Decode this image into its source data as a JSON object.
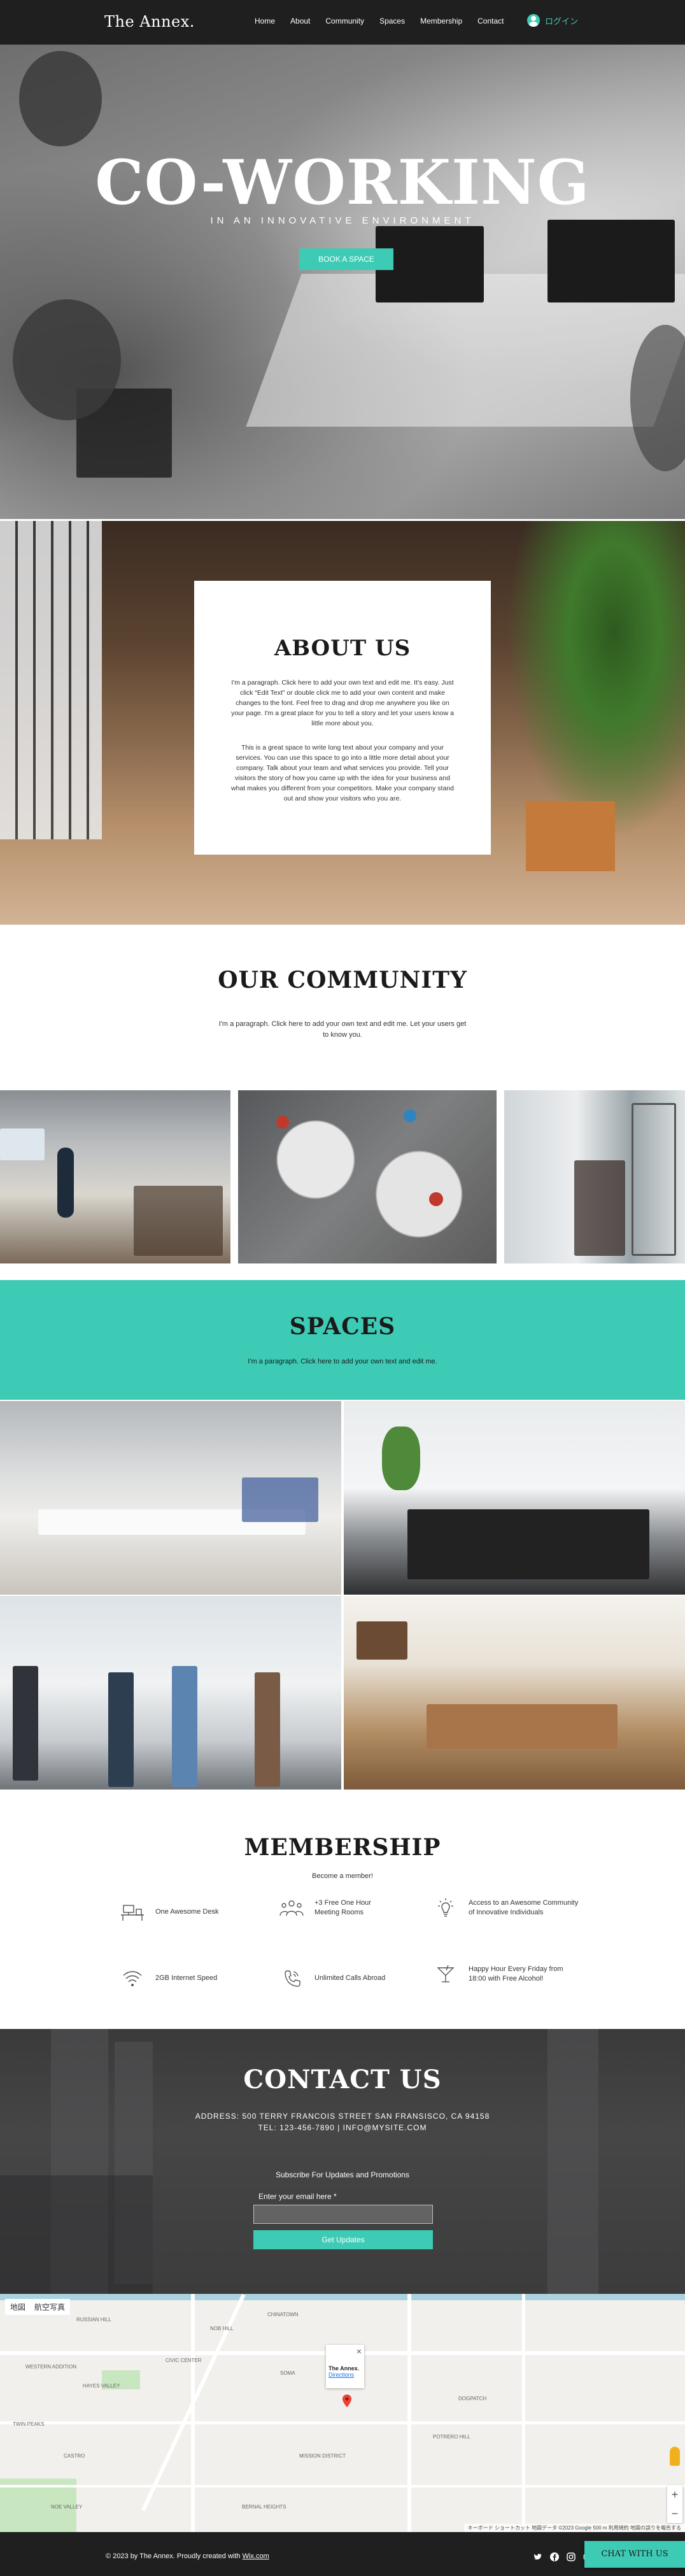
{
  "header": {
    "logo": "The Annex.",
    "nav": [
      "Home",
      "About",
      "Community",
      "Spaces",
      "Membership",
      "Contact"
    ],
    "login_label": "ログイン",
    "bg": "#1f1f1f",
    "accent": "#3ecbb5"
  },
  "hero": {
    "title": "CO-WORKING",
    "subtitle": "IN AN INNOVATIVE ENVIRONMENT",
    "button": "BOOK A SPACE"
  },
  "about": {
    "title": "ABOUT US",
    "p1": "I'm a paragraph. Click here to add your own text and edit me. It's easy. Just click “Edit Text” or double click me to add your own content and make changes to the font. Feel free to drag and drop me anywhere you like on your page. I'm a great place for you to tell a story and let your users know a little more about you.",
    "p2": "This is a great space to write long text about your company and your services. You can use this space to go into a little more detail about your company. Talk about your team and what services you provide. Tell your visitors the story of how you came up with the idea for your business and what makes you different from your competitors. Make your company stand out and show your visitors who you are."
  },
  "community": {
    "title": "OUR COMMUNITY",
    "text": "I'm a paragraph. Click here to add your own text and edit me. Let your users get to know you."
  },
  "spaces": {
    "title": "SPACES",
    "text": "I'm a paragraph. Click here to add your own text and edit me."
  },
  "membership": {
    "title": "MEMBERSHIP",
    "subtitle": "Become a member!",
    "perks": [
      {
        "icon": "desk-icon",
        "text": "One Awesome Desk"
      },
      {
        "icon": "meeting-people-icon",
        "text": "+3 Free One Hour Meeting Rooms"
      },
      {
        "icon": "lightbulb-icon",
        "text": "Access to an Awesome Community of Innovative Individuals"
      },
      {
        "icon": "wifi-icon",
        "text": "2GB Internet Speed"
      },
      {
        "icon": "phone-icon",
        "text": "Unlimited Calls Abroad"
      },
      {
        "icon": "cocktail-icon",
        "text": "Happy Hour Every Friday from 18:00 with Free Alcohol!"
      }
    ]
  },
  "contact": {
    "title": "CONTACT US",
    "address": "ADDRESS: 500 TERRY FRANCOIS STREET SAN FRANSISCO, CA 94158",
    "tel": "TEL: 123-456-7890  |  INFO@MYSITE.COM",
    "subscribe": "Subscribe For Updates and Promotions",
    "email_label": "Enter your email here *",
    "email_value": "",
    "button": "Get Updates"
  },
  "map": {
    "tabs": [
      "地図",
      "航空写真"
    ],
    "popup_title": "The Annex.",
    "popup_link": "Directions",
    "labels": [
      "RUSSIAN HILL",
      "NOB HILL",
      "CHINATOWN",
      "WESTERN ADDITION",
      "HAYES VALLEY",
      "MISSION DISTRICT",
      "POTRERO HILL",
      "CASTRO",
      "NOE VALLEY",
      "SOMA",
      "TWIN PEAKS",
      "BERNAL HEIGHTS",
      "CIVIC CENTER",
      "DOGPATCH"
    ],
    "footer": "キーボード ショートカット   地図データ ©2023 Google   500 m   利用規約   地図の誤りを報告する"
  },
  "footer": {
    "copyright": "© 2023 by The Annex. Proudly created with",
    "wix_link": "Wix.com",
    "social": [
      "twitter-icon",
      "facebook-icon",
      "instagram-icon",
      "youtube-icon"
    ],
    "chat": "CHAT WITH US"
  }
}
